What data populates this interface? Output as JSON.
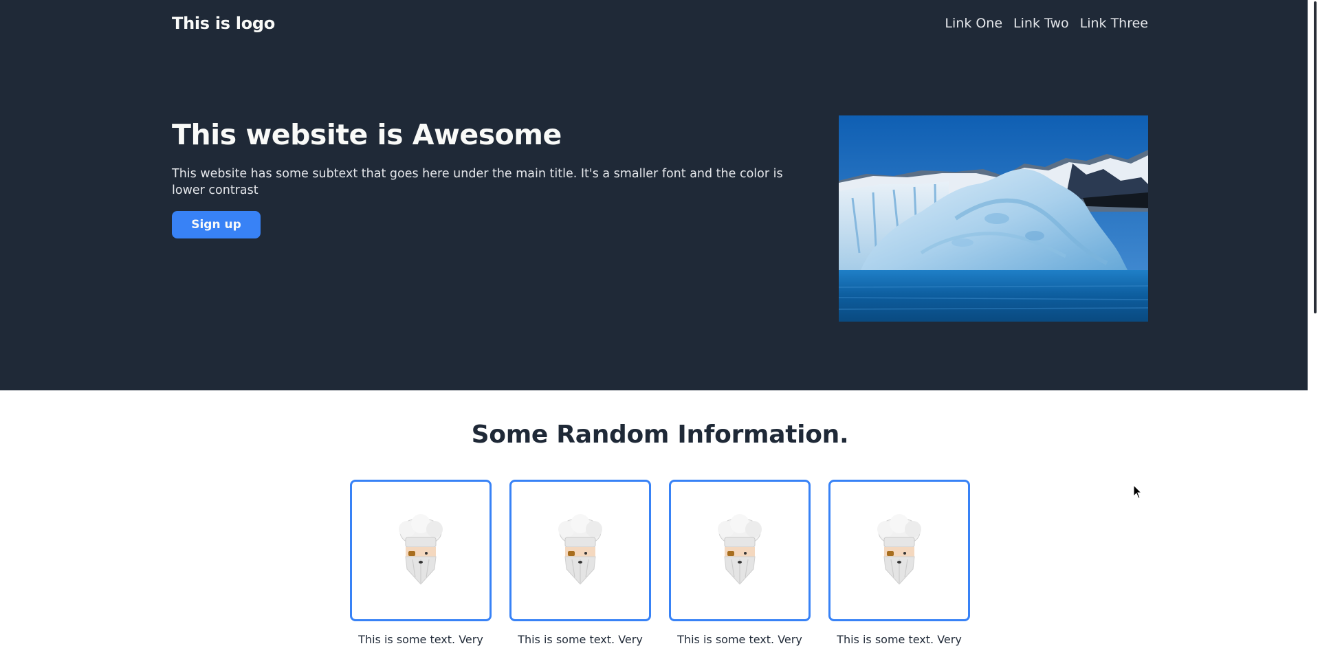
{
  "header": {
    "logo": "This is logo",
    "nav": [
      {
        "label": "Link One"
      },
      {
        "label": "Link Two"
      },
      {
        "label": "Link Three"
      }
    ]
  },
  "hero": {
    "title": "This website is Awesome",
    "subtitle": "This website has some subtext that goes here under the main title. It's a smaller font and the color is lower contrast",
    "button_label": "Sign up",
    "image_icon": "iceberg-photo"
  },
  "info": {
    "title": "Some Random Information.",
    "cards": [
      {
        "icon": "chef-icon",
        "text": "This is some text. Very"
      },
      {
        "icon": "chef-icon",
        "text": "This is some text. Very"
      },
      {
        "icon": "chef-icon",
        "text": "This is some text. Very"
      },
      {
        "icon": "chef-icon",
        "text": "This is some text. Very"
      }
    ]
  },
  "colors": {
    "hero_bg": "#1f2937",
    "accent": "#3882f6",
    "light_text": "#f9faf8",
    "muted_text": "#e5e7eb",
    "dark_text": "#1f2937"
  }
}
